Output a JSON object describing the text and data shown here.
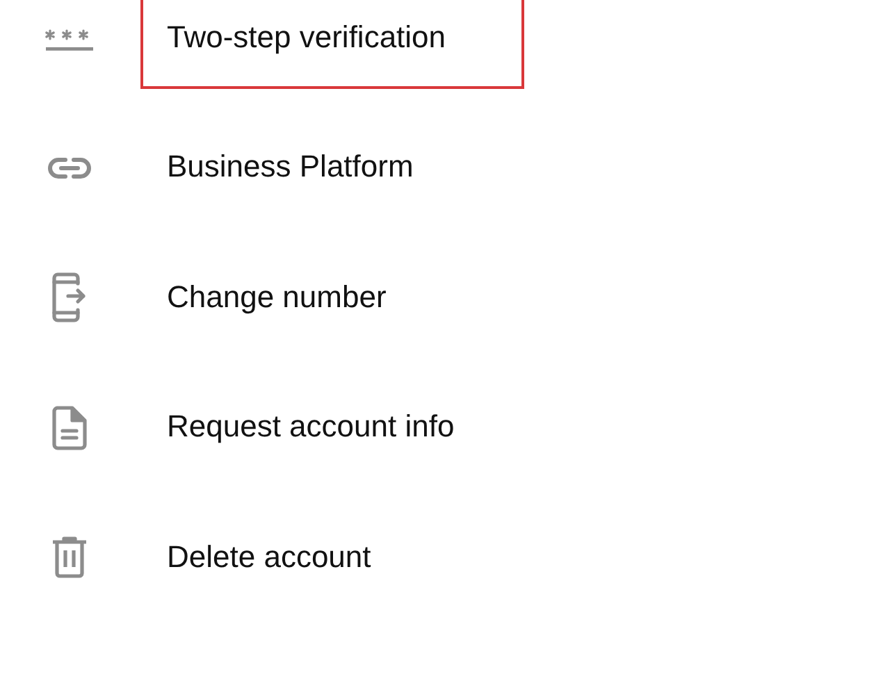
{
  "settings_items": [
    {
      "kind": "password",
      "label": "Two-step verification",
      "highlighted": true
    },
    {
      "kind": "link",
      "label": "Business Platform",
      "highlighted": false
    },
    {
      "kind": "phone",
      "label": "Change number",
      "highlighted": false
    },
    {
      "kind": "document",
      "label": "Request account info",
      "highlighted": false
    },
    {
      "kind": "trash",
      "label": "Delete account",
      "highlighted": false
    }
  ]
}
